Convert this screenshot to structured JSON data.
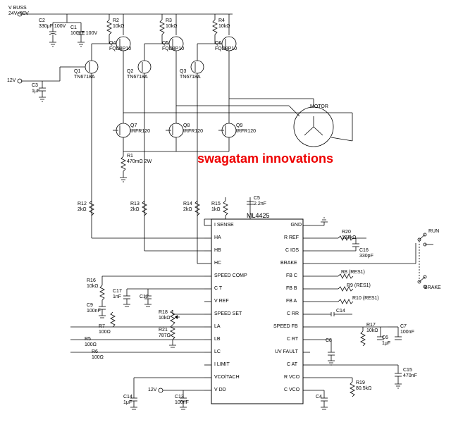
{
  "title_watermark": "swagatam innovations",
  "description": "BLDC motor driver schematic using ML4425 controller IC",
  "power": {
    "vbuss_label": "V BUSS",
    "vbuss_range": "24V–80V",
    "v12_label": "12V",
    "v12_lower_label": "12V"
  },
  "motor": {
    "label": "MOTOR"
  },
  "switches": {
    "run": "RUN",
    "brake": "BRAKE"
  },
  "ic": {
    "name": "ML4425",
    "left_pins": [
      "I SENSE",
      "HA",
      "HB",
      "HC",
      "SPEED COMP",
      "C T",
      "V REF",
      "SPEED SET",
      "LA",
      "LB",
      "LC",
      "I LIMIT",
      "VCO/TACH",
      "V DD"
    ],
    "right_pins": [
      "GND",
      "R REF",
      "C IOS",
      "BRAKE",
      "FB C",
      "FB B",
      "FB A",
      "C RR",
      "SPEED FB",
      "C RT",
      "UV FAULT",
      "C AT",
      "R VCO",
      "C VCO"
    ]
  },
  "components": {
    "C1": "100nF 100V",
    "C2": "330μF 100V",
    "C3": "1μF",
    "C4": "",
    "C5": "2.2nF",
    "C6": "1μF",
    "C7": "100nF",
    "C8": "",
    "C9": "100nF",
    "C12": "",
    "C13": "100nF",
    "C14": "",
    "C14b": "1μF",
    "C15": "470nF",
    "C16": "330pF",
    "C17": "1nF",
    "R1": "470mΩ 2W",
    "R2": "10kΩ",
    "R3": "10kΩ",
    "R4": "10kΩ",
    "R5": "100Ω",
    "R6": "100Ω",
    "R7": "100Ω",
    "R8": "(RES1)",
    "R9": "(RES1)",
    "R10": "(RES1)",
    "R12": "2kΩ",
    "R13": "2kΩ",
    "R14": "2kΩ",
    "R15": "1kΩ",
    "R16": "10kΩ",
    "R17": "10kΩ",
    "R18": "10kΩ",
    "R19": "80.5kΩ",
    "R20": "137kΩ",
    "R21": "787Ω",
    "Q1": "TN6718A",
    "Q2": "TN6718A",
    "Q3": "TN6718A",
    "Q4": "FQD8P10",
    "Q5": "FQD8P10",
    "Q6": "FQD8P10",
    "Q7": "IRFR120",
    "Q8": "IRFR120",
    "Q9": "IRFR120"
  }
}
